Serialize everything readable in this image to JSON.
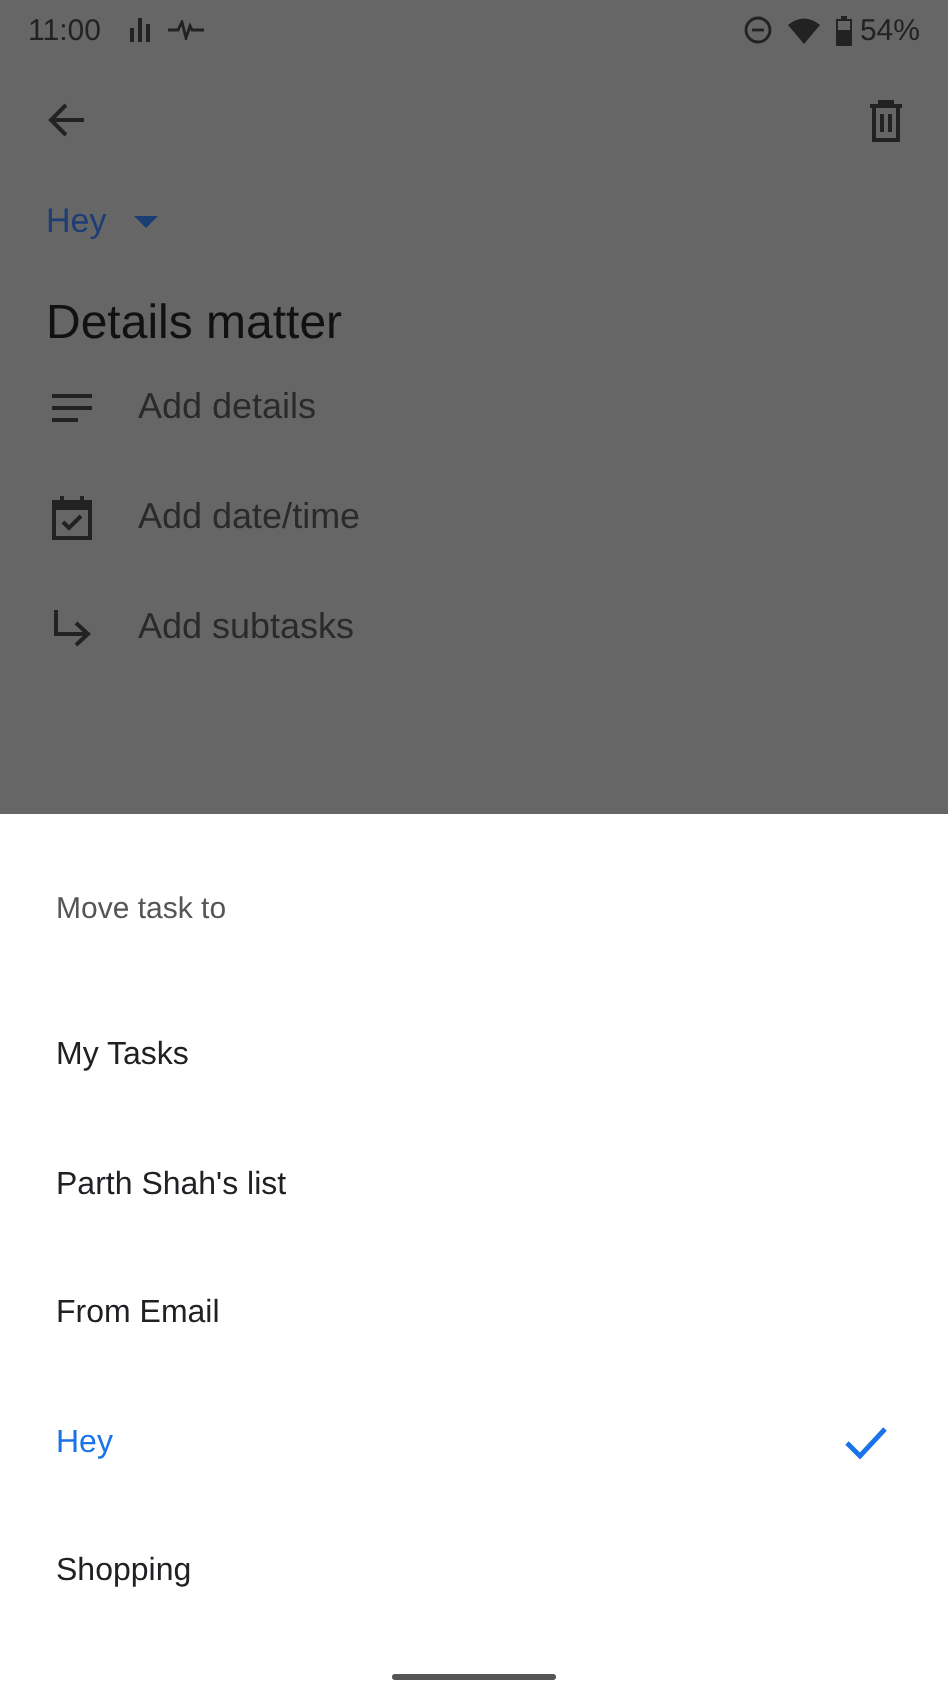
{
  "status_bar": {
    "time": "11:00",
    "battery": "54%"
  },
  "list_chip": {
    "label": "Hey"
  },
  "task": {
    "title": "Details matter"
  },
  "actions": [
    {
      "kind": "details",
      "label": "Add details"
    },
    {
      "kind": "date",
      "label": "Add date/time"
    },
    {
      "kind": "subtasks",
      "label": "Add subtasks"
    }
  ],
  "sheet": {
    "title": "Move task to",
    "lists": [
      {
        "label": "My Tasks",
        "selected": false
      },
      {
        "label": "Parth Shah's list",
        "selected": false
      },
      {
        "label": "From Email",
        "selected": false
      },
      {
        "label": "Hey",
        "selected": true
      },
      {
        "label": "Shopping",
        "selected": false
      }
    ]
  }
}
